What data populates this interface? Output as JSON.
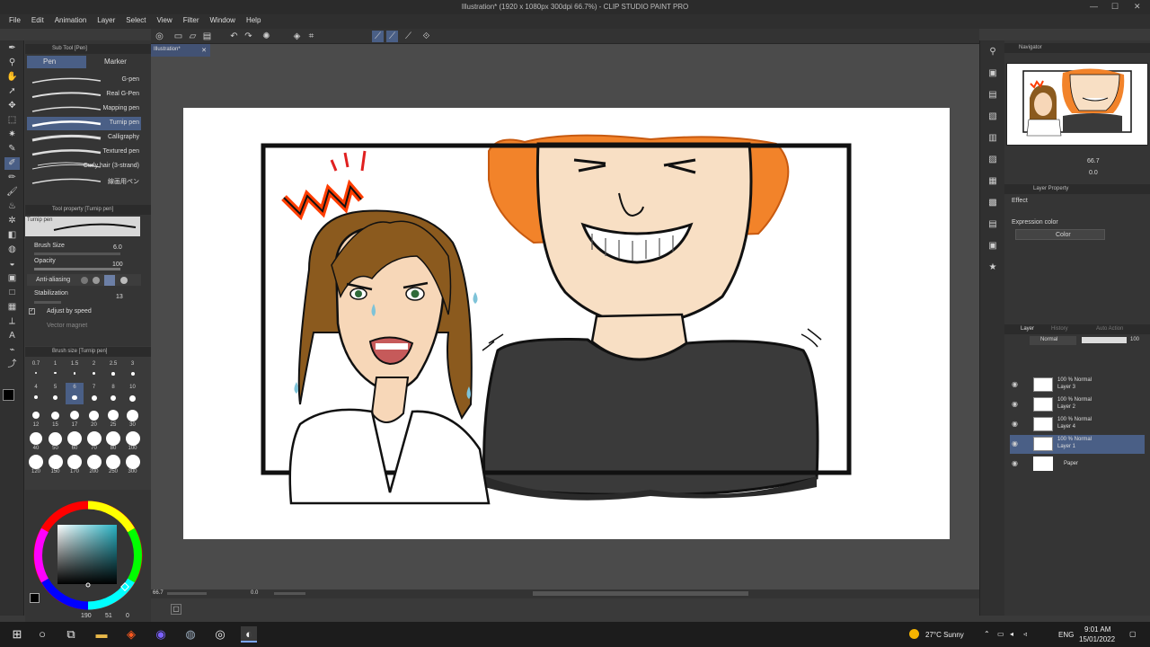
{
  "window": {
    "title": "Illustration* (1920 x 1080px 300dpi 66.7%) - CLIP STUDIO PAINT PRO"
  },
  "menu": [
    "File",
    "Edit",
    "Animation",
    "Layer",
    "Select",
    "View",
    "Filter",
    "Window",
    "Help"
  ],
  "subtool": {
    "header": "Sub Tool [Pen]",
    "tabs": [
      "Pen",
      "Marker"
    ],
    "brushes": [
      "G-pen",
      "Real G-Pen",
      "Mapping pen",
      "Turnip pen",
      "Calligraphy",
      "Textured pen",
      "Curly hair (3-strand)",
      "線画用ペン"
    ],
    "selected_brush": "Turnip pen"
  },
  "tool_property": {
    "header": "Tool property [Turnip pen]",
    "preview_label": "Turnip pen",
    "brush_size_label": "Brush Size",
    "brush_size_value": "6.0",
    "opacity_label": "Opacity",
    "opacity_value": "100",
    "antialiasing_label": "Anti-aliasing",
    "stabilization_label": "Stabilization",
    "stabilization_value": "13",
    "adjust_speed_label": "Adjust by speed",
    "vector_magnet_label": "Vector magnet"
  },
  "brush_size_panel": {
    "header": "Brush size [Turnip pen]",
    "sizes": [
      "0.7",
      "1",
      "1.5",
      "2",
      "2.5",
      "3",
      "4",
      "5",
      "6",
      "7",
      "8",
      "10",
      "12",
      "15",
      "17",
      "20",
      "25",
      "30",
      "40",
      "50",
      "60",
      "70",
      "80",
      "100",
      "120",
      "150",
      "170",
      "200",
      "250",
      "300"
    ]
  },
  "color": {
    "values": [
      "190",
      "51",
      "0"
    ],
    "main_color": "#000000",
    "sub_color": "#ffffff"
  },
  "document": {
    "tab": "Illustration*"
  },
  "status": {
    "zoom": "66.7",
    "angle": "0.0"
  },
  "navigator": {
    "header": "Navigator",
    "zoom": "66.7",
    "angle": "0.0"
  },
  "layer_property": {
    "header": "Layer Property",
    "effect_label": "Effect",
    "expression_color_label": "Expression color",
    "expression_color_value": "Color"
  },
  "layer_panel": {
    "tabs": [
      "Layer",
      "History",
      "Auto Action"
    ],
    "blend_mode": "Normal",
    "opacity": "100",
    "layers": [
      {
        "top": "100 % Normal",
        "name": "Layer 3"
      },
      {
        "top": "100 % Normal",
        "name": "Layer 2"
      },
      {
        "top": "100 % Normal",
        "name": "Layer 4"
      },
      {
        "top": "100 % Normal",
        "name": "Layer 1"
      },
      {
        "top": "",
        "name": "Paper"
      }
    ]
  },
  "taskbar": {
    "weather": "27°C  Sunny",
    "lang": "ENG",
    "time": "9:01 AM",
    "date": "15/01/2022"
  }
}
